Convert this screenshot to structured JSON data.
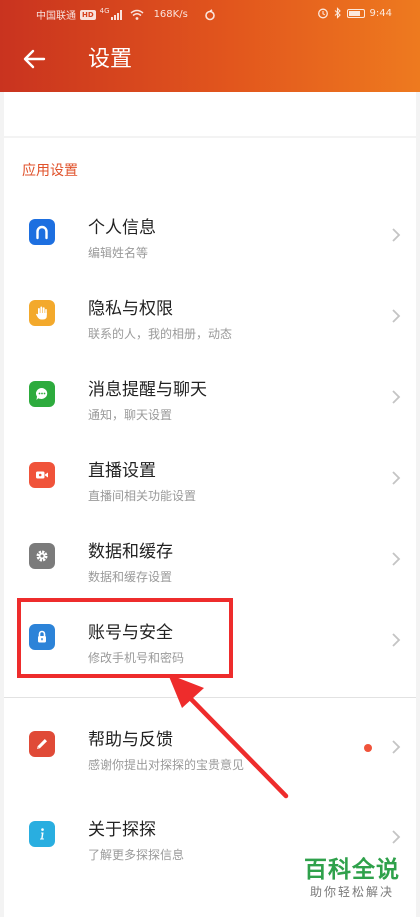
{
  "status_bar": {
    "carrier": "中国联通",
    "hd": "HD",
    "network": "4G",
    "speed": "168K/s",
    "time": "9:44",
    "battery_level": 0.8
  },
  "app_bar": {
    "title": "设置",
    "back_icon": "arrow-left-icon"
  },
  "section": {
    "title": "应用设置"
  },
  "items": [
    {
      "title": "个人信息",
      "subtitle": "编辑姓名等",
      "icon": "profile-icon",
      "color": "#1d6fe0"
    },
    {
      "title": "隐私与权限",
      "subtitle": "联系的人，我的相册，动态",
      "icon": "hand-icon",
      "color": "#f3a92c"
    },
    {
      "title": "消息提醒与聊天",
      "subtitle": "通知，聊天设置",
      "icon": "chat-icon",
      "color": "#2dab3d"
    },
    {
      "title": "直播设置",
      "subtitle": "直播间相关功能设置",
      "icon": "video-camera-icon",
      "color": "#f0533a"
    },
    {
      "title": "数据和缓存",
      "subtitle": "数据和缓存设置",
      "icon": "gear-icon",
      "color": "#7b7b7b"
    },
    {
      "title": "账号与安全",
      "subtitle": "修改手机号和密码",
      "icon": "lock-icon",
      "color": "#2c83d8"
    },
    {
      "title": "帮助与反馈",
      "subtitle": "感谢你提出对探探的宝贵意见",
      "icon": "pencil-icon",
      "color": "#e04a37",
      "badge_color": "#f0533a"
    },
    {
      "title": "关于探探",
      "subtitle": "了解更多探探信息",
      "icon": "info-icon",
      "color": "#29aee0"
    }
  ],
  "annotation": {
    "highlight_color": "#ee2c2c"
  },
  "watermark": {
    "main": "百科全说",
    "sub": "助你轻松解决"
  }
}
